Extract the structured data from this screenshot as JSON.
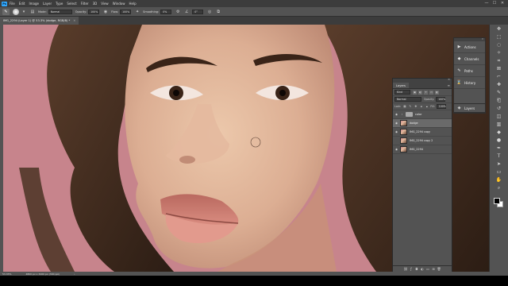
{
  "app": {
    "logo": "Ps"
  },
  "menu": [
    "File",
    "Edit",
    "Image",
    "Layer",
    "Type",
    "Select",
    "Filter",
    "3D",
    "View",
    "Window",
    "Help"
  ],
  "window_controls": {
    "minimize": "—",
    "maximize": "☐",
    "close": "✕"
  },
  "options": {
    "mode_label": "Mode:",
    "mode_value": "Normal",
    "opacity_label": "Opacity:",
    "opacity_value": "100%",
    "flow_label": "Flow:",
    "flow_value": "100%",
    "smoothing_label": "Smoothing:",
    "smoothing_value": "0%",
    "angle_value": "0°"
  },
  "document": {
    "tab_title": "IMG_2294 (Layer 1) @ 53.3% (dodge, RGB/8) *",
    "close": "✕"
  },
  "status": {
    "zoom": "53.33%",
    "doc_info": "4800 px x 3200 px (300 ppi)",
    "arrow": "›"
  },
  "dock": {
    "items": [
      {
        "icon": "▶",
        "label": "Actions"
      },
      {
        "icon": "◆",
        "label": "Channels"
      },
      {
        "icon": "✎",
        "label": "Paths"
      },
      {
        "icon": "⌛",
        "label": "History"
      }
    ],
    "layers_tab": {
      "icon": "◈",
      "label": "Layers"
    }
  },
  "layers_panel": {
    "tab_label": "Layers",
    "menu": "≡",
    "kind_value": "Kind",
    "blend_value": "Normal",
    "opacity_label": "Opacity:",
    "opacity_value": "100%",
    "lock_label": "Lock:",
    "fill_label": "Fill:",
    "fill_value": "100%",
    "layers": [
      {
        "name": "color",
        "visible": true,
        "type": "group"
      },
      {
        "name": "dodge",
        "visible": true,
        "type": "layer"
      },
      {
        "name": "IMG_2294 copy",
        "visible": true,
        "type": "layer"
      },
      {
        "name": "IMG_2294 copy 2",
        "visible": false,
        "type": "layer"
      },
      {
        "name": "IMG_2294",
        "visible": true,
        "type": "layer"
      }
    ]
  },
  "colors": {
    "backdrop": "#c7848c",
    "skin": "#e2b79c",
    "hair": "#3e2a1e",
    "ui_panel": "#535353"
  }
}
